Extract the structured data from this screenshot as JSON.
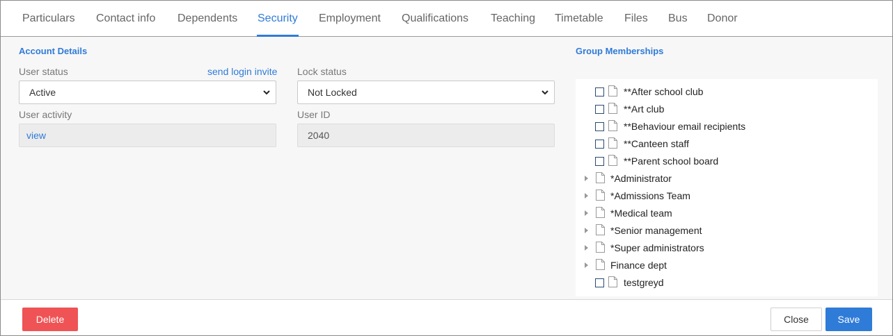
{
  "tabs": [
    {
      "label": "Particulars",
      "active": false
    },
    {
      "label": "Contact info",
      "active": false
    },
    {
      "label": "Dependents",
      "active": false
    },
    {
      "label": "Security",
      "active": true
    },
    {
      "label": "Employment",
      "active": false
    },
    {
      "label": "Qualifications",
      "active": false
    },
    {
      "label": "Teaching",
      "active": false
    },
    {
      "label": "Timetable",
      "active": false
    },
    {
      "label": "Files",
      "active": false
    },
    {
      "label": "Bus",
      "active": false
    },
    {
      "label": "Donor",
      "active": false
    }
  ],
  "account": {
    "title": "Account Details",
    "user_status_label": "User status",
    "send_invite_link": "send login invite",
    "user_status_value": "Active",
    "lock_status_label": "Lock status",
    "lock_status_value": "Not Locked",
    "user_activity_label": "User activity",
    "user_activity_link": "view",
    "user_id_label": "User ID",
    "user_id_value": "2040"
  },
  "groups": {
    "title": "Group Memberships",
    "items": [
      {
        "label": "**After school club",
        "kind": "checkbox",
        "checked": false
      },
      {
        "label": "**Art club",
        "kind": "checkbox",
        "checked": false
      },
      {
        "label": "**Behaviour email recipients",
        "kind": "checkbox",
        "checked": false
      },
      {
        "label": "**Canteen staff",
        "kind": "checkbox",
        "checked": false
      },
      {
        "label": "**Parent school board",
        "kind": "checkbox",
        "checked": false
      },
      {
        "label": "*Administrator",
        "kind": "expandable"
      },
      {
        "label": "*Admissions Team",
        "kind": "expandable"
      },
      {
        "label": "*Medical team",
        "kind": "expandable"
      },
      {
        "label": "*Senior management",
        "kind": "expandable"
      },
      {
        "label": "*Super administrators",
        "kind": "expandable"
      },
      {
        "label": "Finance dept",
        "kind": "expandable"
      },
      {
        "label": "testgreyd",
        "kind": "checkbox",
        "checked": false
      }
    ]
  },
  "footer": {
    "delete_label": "Delete",
    "close_label": "Close",
    "save_label": "Save"
  },
  "colors": {
    "accent": "#2f7bd8",
    "danger": "#ef5355"
  },
  "icons": {
    "dropdown": "chevron-down-icon",
    "document": "document-icon",
    "expand": "triangle-right-icon",
    "checkbox": "checkbox-icon"
  }
}
